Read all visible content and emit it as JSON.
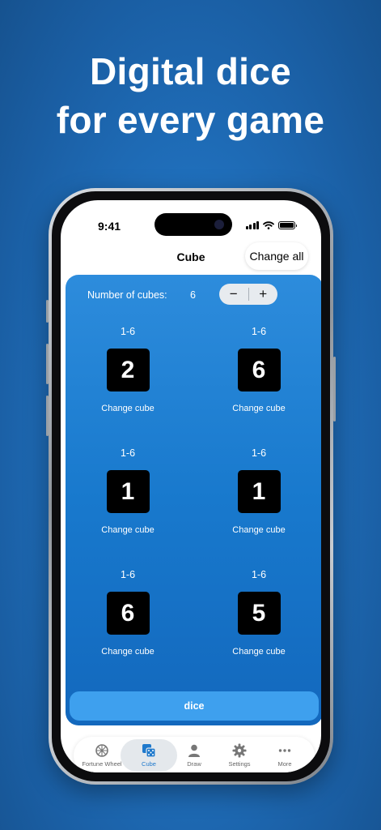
{
  "promo": {
    "line1": "Digital dice",
    "line2": "for every game"
  },
  "status_bar": {
    "time": "9:41",
    "icons": [
      "signal-icon",
      "wifi-icon",
      "battery-icon"
    ]
  },
  "nav": {
    "title": "Cube",
    "change_all_label": "Change all"
  },
  "cubes": {
    "count_label": "Number of cubes:",
    "count": "6",
    "decrement_label": "−",
    "increment_label": "+",
    "items": [
      {
        "range": "1-6",
        "value": "2",
        "change_label": "Change cube"
      },
      {
        "range": "1-6",
        "value": "6",
        "change_label": "Change cube"
      },
      {
        "range": "1-6",
        "value": "1",
        "change_label": "Change cube"
      },
      {
        "range": "1-6",
        "value": "1",
        "change_label": "Change cube"
      },
      {
        "range": "1-6",
        "value": "6",
        "change_label": "Change cube"
      },
      {
        "range": "1-6",
        "value": "5",
        "change_label": "Change cube"
      }
    ],
    "roll_label": "dice"
  },
  "tabs": [
    {
      "label": "Fortune Wheel",
      "icon": "wheel-icon"
    },
    {
      "label": "Cube",
      "icon": "dice-icon",
      "active": true
    },
    {
      "label": "Draw",
      "icon": "person-icon"
    },
    {
      "label": "Settings",
      "icon": "gear-icon"
    },
    {
      "label": "More",
      "icon": "more-icon"
    }
  ],
  "colors": {
    "background": "#1f6fbe",
    "panel": "#1879cd",
    "accent": "#1f79cc",
    "dice_button": "#3ea0ee"
  }
}
